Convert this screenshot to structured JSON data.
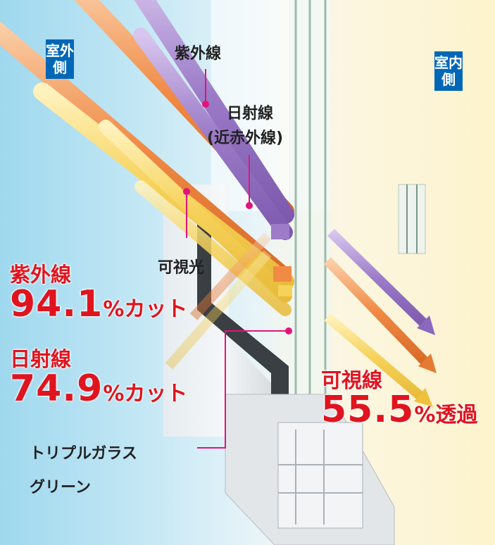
{
  "outdoor_label": "室外側",
  "indoor_label": "室内側",
  "labels": {
    "uv": "紫外線",
    "solar_line1": "日射線",
    "solar_line2": "(近赤外線)",
    "visible": "可視光",
    "product_line1": "トリプルガラス",
    "product_line2": "グリーン"
  },
  "stats": [
    {
      "name": "紫外線",
      "value": "94.1",
      "suffix": "%カット"
    },
    {
      "name": "日射線",
      "value": "74.9",
      "suffix": "%カット"
    },
    {
      "name": "可視線",
      "value": "55.5",
      "suffix": "%透過"
    }
  ],
  "colors": {
    "uv_beam": "#a98bcf",
    "solar_beam": "#f39a59",
    "visible_beam": "#f7d66a",
    "stat_red": "#e0141e",
    "tag_blue": "#0067b7",
    "leader_pink": "#e4137a"
  }
}
